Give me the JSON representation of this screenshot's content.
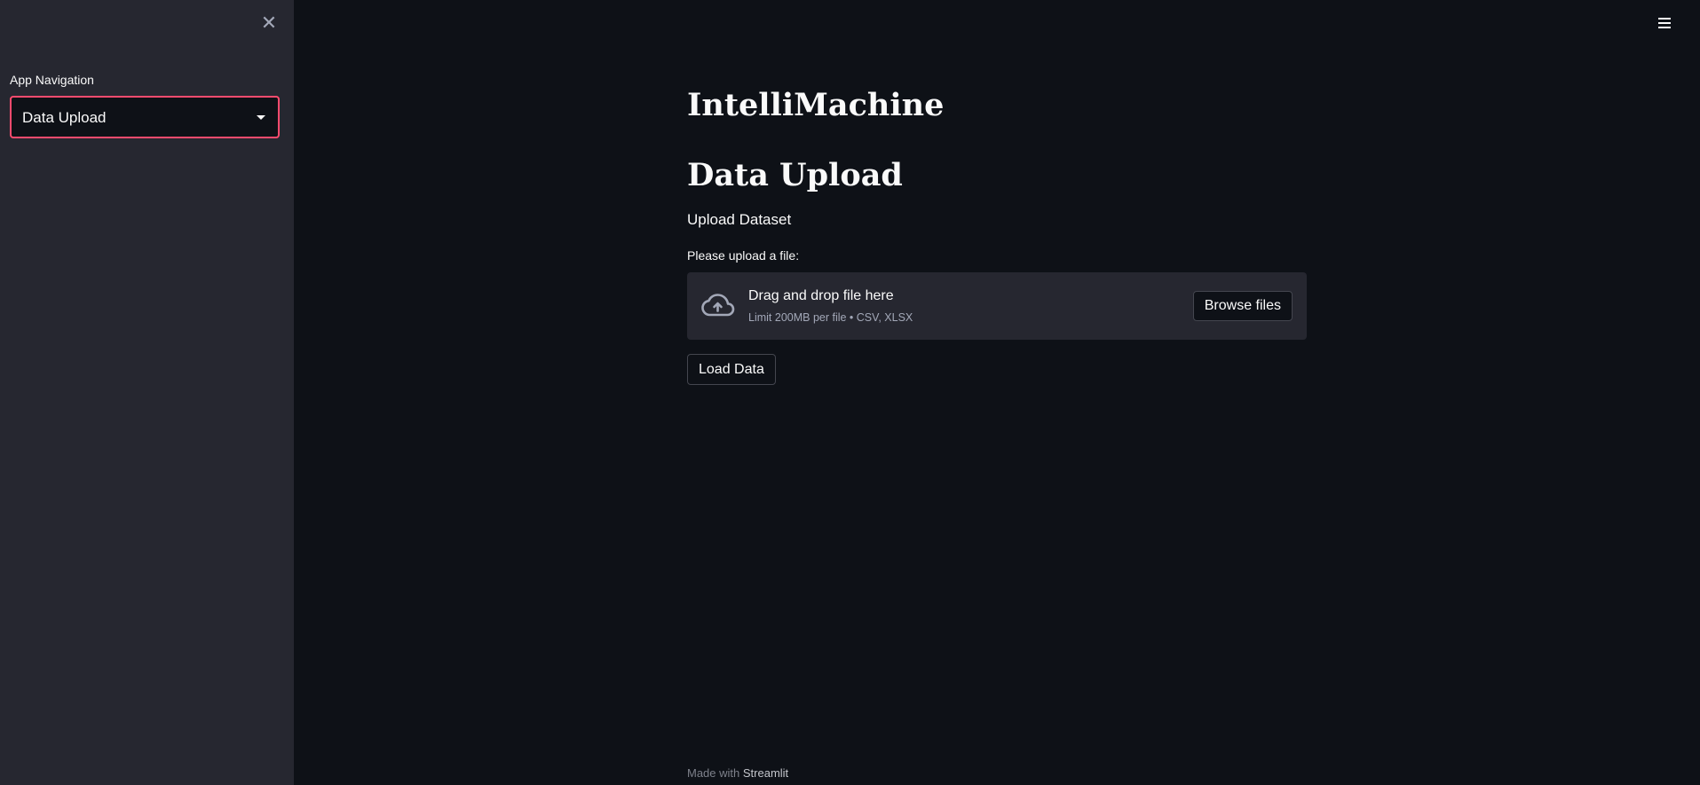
{
  "sidebar": {
    "close_icon": "close-icon",
    "nav_label": "App Navigation",
    "nav_select": {
      "selected": "Data Upload"
    }
  },
  "header": {
    "menu_icon": "hamburger-menu-icon"
  },
  "main": {
    "app_title": "IntelliMachine",
    "page_title": "Data Upload",
    "section_text": "Upload Dataset",
    "uploader": {
      "label": "Please upload a file:",
      "drop_title": "Drag and drop file here",
      "limit_text": "Limit 200MB per file • CSV, XLSX",
      "browse_label": "Browse files",
      "icon": "cloud-upload-icon"
    },
    "load_button_label": "Load Data"
  },
  "footer": {
    "prefix": "Made with",
    "link": "Streamlit"
  },
  "colors": {
    "background": "#0e1117",
    "sidebar_background": "#262730",
    "accent": "#ff4b6e",
    "text": "#fafafa",
    "muted_text": "#a3a8b8"
  }
}
